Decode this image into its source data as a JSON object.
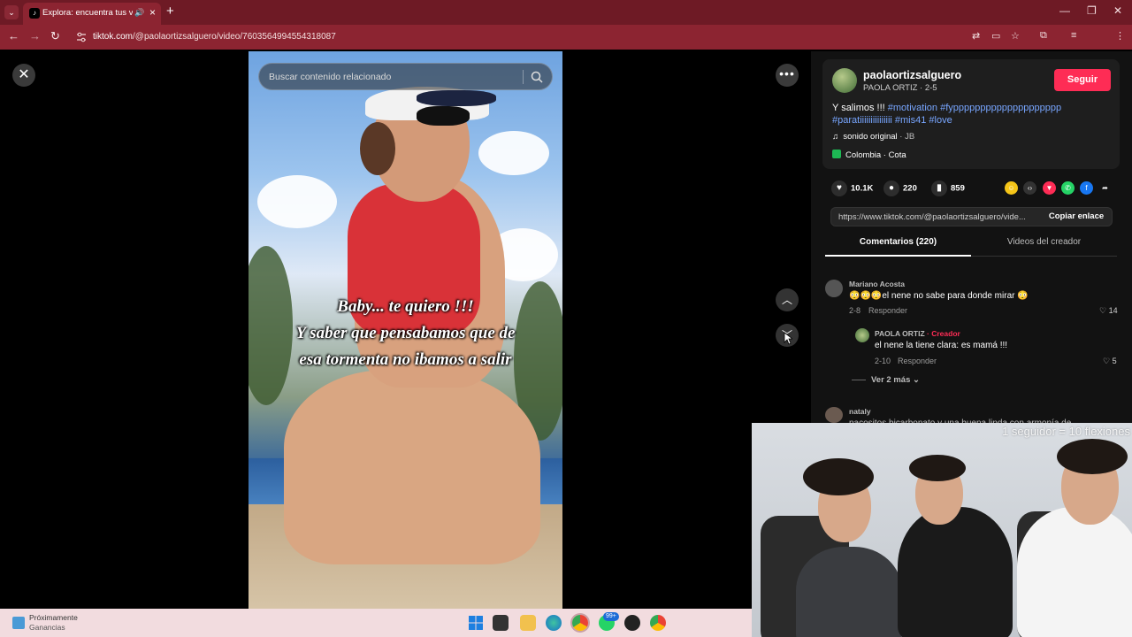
{
  "browser": {
    "tab_title": "Explora: encuentra tus vide",
    "url_host": "tiktok.com",
    "url_path": "/@paolaortizsalguero/video/7603564994554318087"
  },
  "search": {
    "placeholder": "Buscar contenido relacionado"
  },
  "video_caption": {
    "line1": "Baby... te quiero !!!",
    "line2": "Y saber que pensabamos que de",
    "line3": "esa tormenta no ibamos a salir"
  },
  "author": {
    "username": "paolaortizsalguero",
    "subname": "PAOLA ORTIZ · 2-5",
    "follow_label": "Seguir"
  },
  "description": {
    "text": "Y salimos !!! ",
    "tags": "#motivation #fypppppppppppppppppppp #paratiiiiiiiiiiiiiii #mis41 #love",
    "music": "sonido original",
    "music_author": " · JB",
    "location": "Colombia · Cota"
  },
  "stats": {
    "likes": "10.1K",
    "comments": "220",
    "saves": "859"
  },
  "share": {
    "link": "https://www.tiktok.com/@paolaortizsalguero/vide...",
    "copy_label": "Copiar enlace"
  },
  "tabs": {
    "comments": "Comentarios (220)",
    "videos": "Videos del creador"
  },
  "comments": [
    {
      "author": "Mariano Acosta",
      "text": "😳😳😳el nene no sabe para donde mirar 😳",
      "date": "2-8",
      "reply": "Responder",
      "likes": "14"
    },
    {
      "author": "PAOLA ORTIZ",
      "badge": " · Creador",
      "text": "el nene la tiene clara: es mamá !!!",
      "date": "2-10",
      "reply": "Responder",
      "likes": "5"
    }
  ],
  "more_replies": "Ver 2 más",
  "next_comment": {
    "author": "nataly",
    "text": "pacositos bicarbonato y una buena linda con armonía de"
  },
  "webcam": {
    "caption": "1 seguidor = 10 flexiones"
  },
  "taskbar": {
    "widget_title": "Próximamente",
    "widget_sub": "Ganancias",
    "badge": "99+"
  },
  "colors": {
    "accent": "#fe2c55",
    "tag": "#78a6ff",
    "browser_frame": "#8c2431"
  }
}
